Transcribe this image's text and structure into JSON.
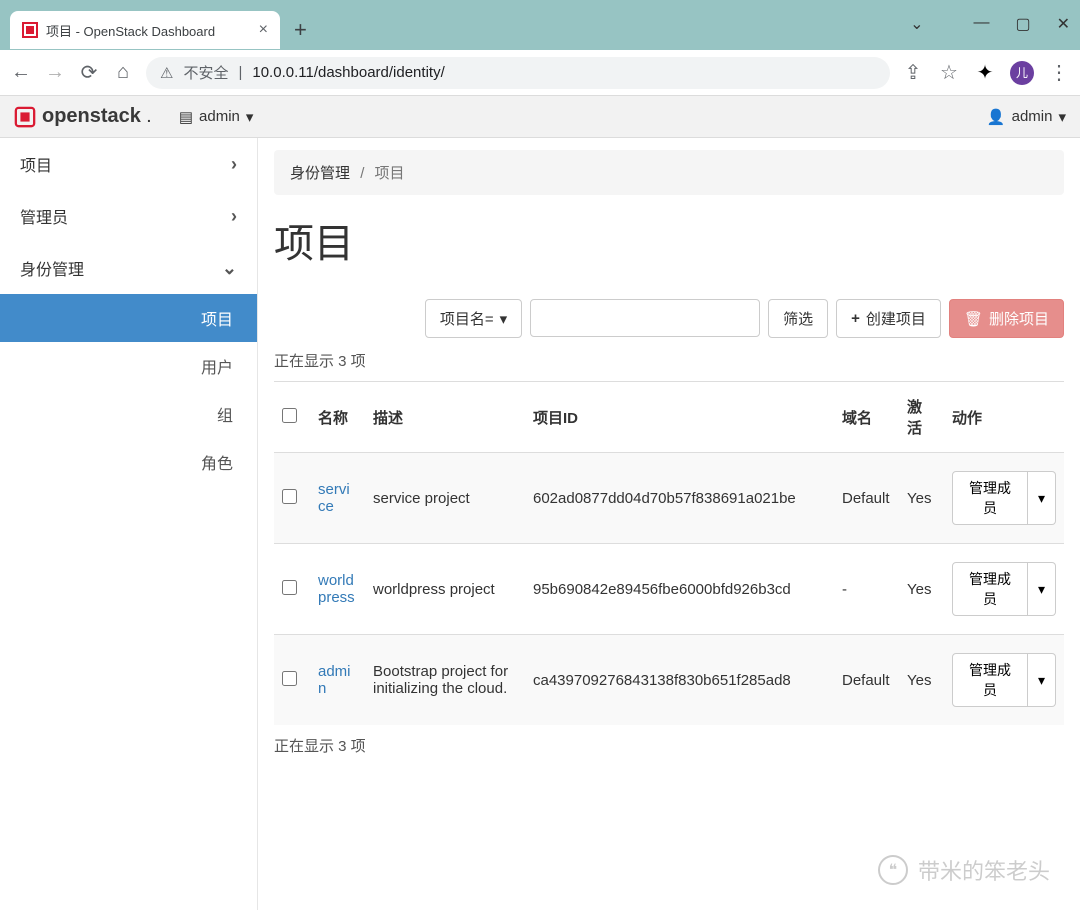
{
  "browser": {
    "tab_title": "项目 - OpenStack Dashboard",
    "new_tab": "+",
    "security_label": "不安全",
    "url_display": "10.0.0.11/dashboard/identity/",
    "avatar_initial": "儿"
  },
  "header": {
    "brand": "openstack",
    "project_selector": "admin",
    "user_menu": "admin"
  },
  "sidebar": {
    "items": [
      {
        "label": "项目",
        "expanded": false
      },
      {
        "label": "管理员",
        "expanded": false
      },
      {
        "label": "身份管理",
        "expanded": true
      }
    ],
    "sub_items": [
      {
        "label": "项目",
        "active": true
      },
      {
        "label": "用户",
        "active": false
      },
      {
        "label": "组",
        "active": false
      },
      {
        "label": "角色",
        "active": false
      }
    ]
  },
  "breadcrumb": {
    "parent": "身份管理",
    "sep": "/",
    "current": "项目"
  },
  "page": {
    "title": "项目"
  },
  "toolbar": {
    "filter_field": "项目名=",
    "filter_value": "",
    "filter_btn": "筛选",
    "create_btn": "创建项目",
    "delete_btn": "删除项目"
  },
  "table": {
    "count_top": "正在显示 3 项",
    "count_bottom": "正在显示 3 项",
    "headers": {
      "name": "名称",
      "desc": "描述",
      "id": "项目ID",
      "domain": "域名",
      "active": "激活",
      "action": "动作"
    },
    "rows": [
      {
        "name": "service",
        "desc": "service project",
        "id": "602ad0877dd04d70b57f838691a021be",
        "domain": "Default",
        "active": "Yes",
        "action": "管理成员"
      },
      {
        "name": "worldpress",
        "desc": "worldpress project",
        "id": "95b690842e89456fbe6000bfd926b3cd",
        "domain": "-",
        "active": "Yes",
        "action": "管理成员"
      },
      {
        "name": "admin",
        "desc": "Bootstrap project for initializing the cloud.",
        "id": "ca439709276843138f830b651f285ad8",
        "domain": "Default",
        "active": "Yes",
        "action": "管理成员"
      }
    ]
  },
  "watermark": {
    "text": "带米的笨老头"
  }
}
